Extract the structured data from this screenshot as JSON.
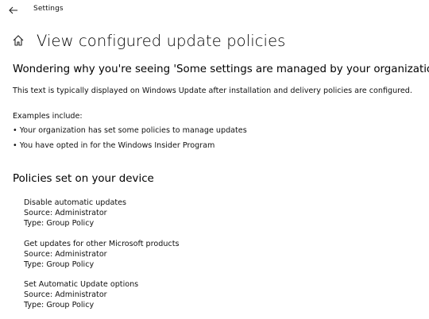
{
  "window": {
    "app_title": "Settings",
    "back_icon": "arrow-left-icon"
  },
  "header": {
    "home_icon": "home-icon",
    "title": "View configured update policies"
  },
  "intro": {
    "heading": "Wondering why you're seeing 'Some settings are managed by your organization'?",
    "description": "This text is typically displayed on Windows Update after installation and delivery policies are configured.",
    "examples_label": "Examples include:",
    "examples": [
      "• Your organization has set some policies to manage updates",
      "• You have opted in for the Windows Insider Program"
    ]
  },
  "policies_section": {
    "heading": "Policies set on your device",
    "policies": [
      {
        "name": "Disable automatic updates",
        "source": "Source: Administrator",
        "type": "Type: Group Policy"
      },
      {
        "name": "Get updates for other Microsoft products",
        "source": "Source: Administrator",
        "type": "Type: Group Policy"
      },
      {
        "name": "Set Automatic Update options",
        "source": "Source: Administrator",
        "type": "Type: Group Policy"
      }
    ]
  }
}
